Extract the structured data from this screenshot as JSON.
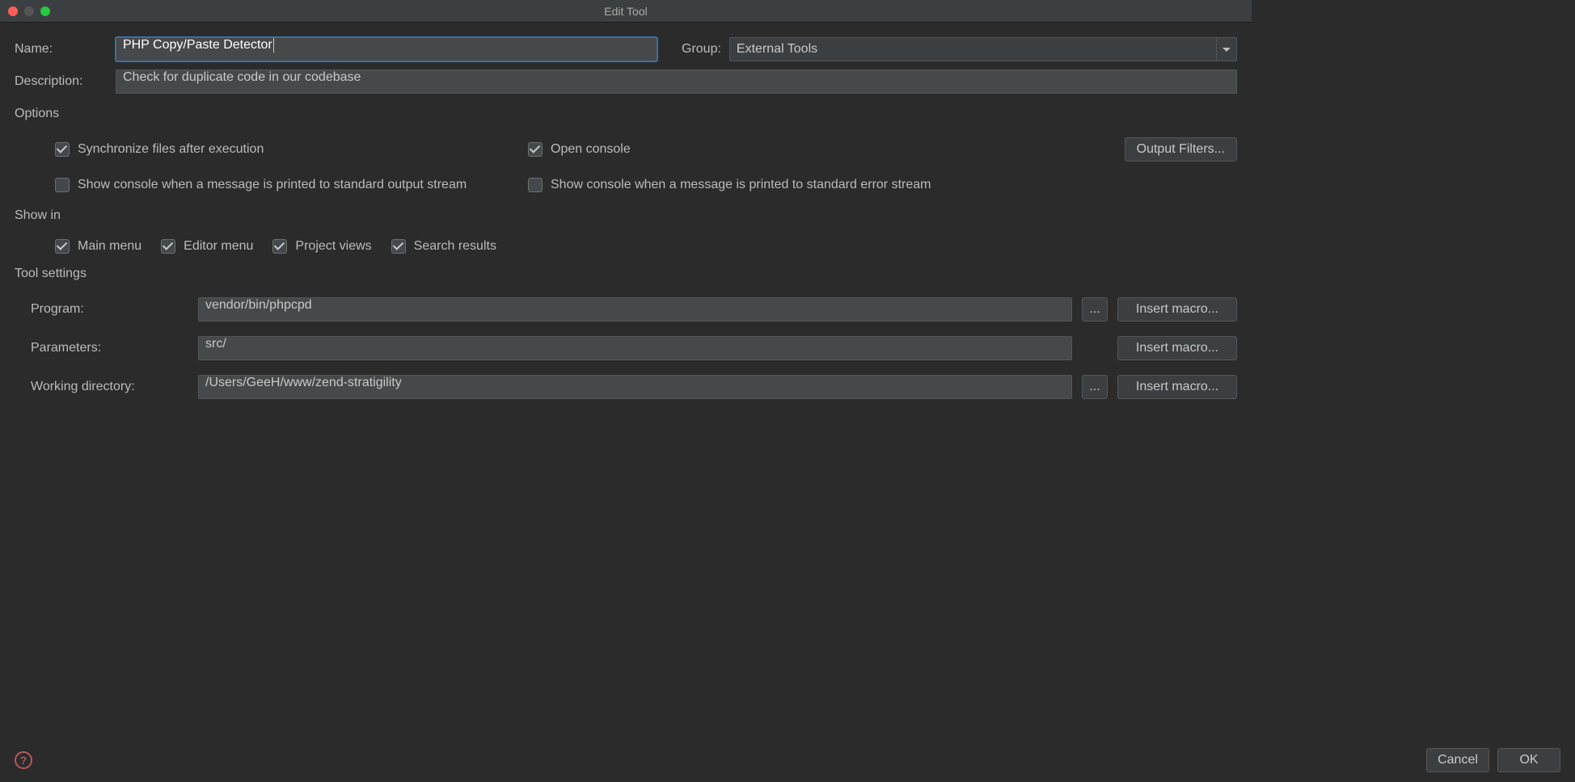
{
  "window": {
    "title": "Edit Tool"
  },
  "labels": {
    "name": "Name:",
    "group": "Group:",
    "description": "Description:",
    "options": "Options",
    "showIn": "Show in",
    "toolSettings": "Tool settings",
    "program": "Program:",
    "parameters": "Parameters:",
    "workingDirectory": "Working directory:"
  },
  "fields": {
    "name": "PHP Copy/Paste Detector",
    "group": "External Tools",
    "description": "Check for duplicate code in our codebase",
    "program": "vendor/bin/phpcpd",
    "parameters": "src/",
    "workingDirectory": "/Users/GeeH/www/zend-stratigility"
  },
  "options": {
    "syncFiles": "Synchronize files after execution",
    "openConsole": "Open console",
    "showStdout": "Show console when a message is printed to standard output stream",
    "showStderr": "Show console when a message is printed to standard error stream"
  },
  "showInItems": {
    "mainMenu": "Main menu",
    "editorMenu": "Editor menu",
    "projectViews": "Project views",
    "searchResults": "Search results"
  },
  "buttons": {
    "outputFilters": "Output Filters...",
    "insertMacro": "Insert macro...",
    "browse": "...",
    "cancel": "Cancel",
    "ok": "OK",
    "help": "?"
  }
}
